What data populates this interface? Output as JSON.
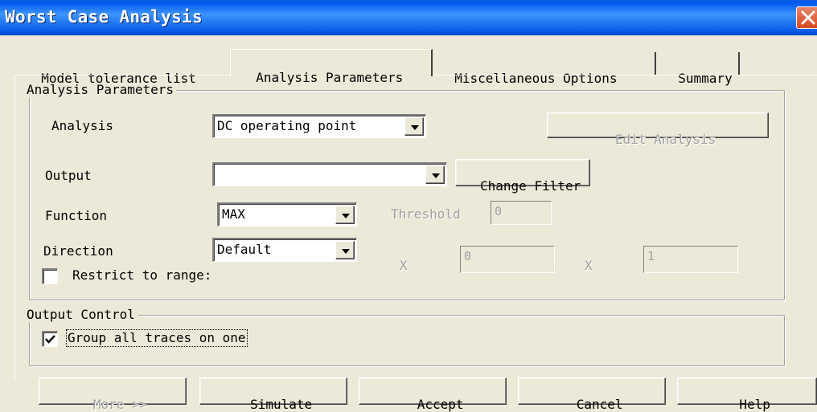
{
  "window": {
    "title": "Worst Case Analysis",
    "close_icon": "close-icon"
  },
  "tabs": [
    {
      "label": "Model tolerance list",
      "selected": false
    },
    {
      "label": "Analysis Parameters",
      "selected": true
    },
    {
      "label": "Miscellaneous Options",
      "selected": false
    },
    {
      "label": "Summary",
      "selected": false
    }
  ],
  "analysis_parameters": {
    "group_label": "Analysis Parameters",
    "analysis_label": "Analysis",
    "analysis_value": "DC operating point",
    "edit_analysis_button": "Edit Analysis",
    "output_label": "Output",
    "output_value": "",
    "change_filter_button": "Change Filter",
    "function_label": "Function",
    "function_value": "MAX",
    "threshold_label": "Threshold",
    "threshold_value": "0",
    "direction_label": "Direction",
    "direction_value": "Default",
    "range_x1_label": "X",
    "range_x1_value": "0",
    "range_x2_label": "X",
    "range_x2_value": "1",
    "restrict_label": "Restrict to range:",
    "restrict_checked": false
  },
  "output_control": {
    "group_label": "Output Control",
    "group_traces_label": "Group all traces on one",
    "group_traces_checked": true
  },
  "buttons": {
    "more": "More >>",
    "simulate": "Simulate",
    "accept": "Accept",
    "cancel": "Cancel",
    "help": "Help"
  },
  "colors": {
    "titlebar": "#0058ee",
    "dialog_bg": "#ece9d8",
    "close_button": "#d9471f"
  }
}
